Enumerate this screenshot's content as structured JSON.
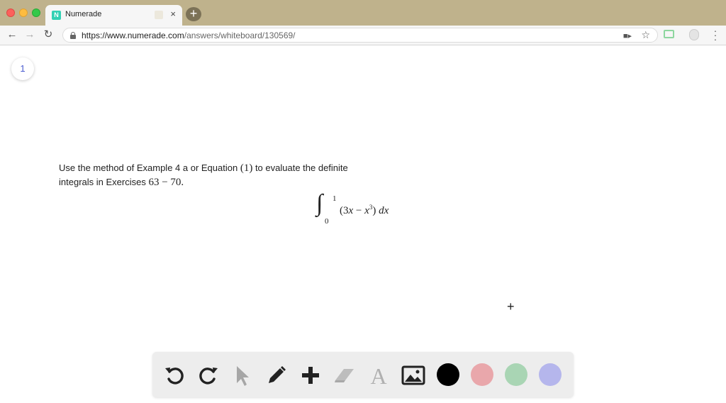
{
  "browser": {
    "tab_title": "Numerade",
    "tab_favicon": "N",
    "tab_close": "×",
    "new_tab": "+",
    "url_host": "https://www.numerade.com",
    "url_path": "/answers/whiteboard/130569/"
  },
  "page": {
    "page_number": "1",
    "problem_line1_text": "Use the method of Example 4 a or Equation ",
    "problem_line1_num": "(1)",
    "problem_line1_rest": " to evaluate the definite",
    "problem_line2_text": "integrals in Exercises ",
    "problem_line2_num": "63 − 70",
    "problem_line2_end": ".",
    "integral": {
      "upper": "1",
      "lower": "0",
      "open": "(3",
      "x1": "x",
      "minus": " − ",
      "x2": "x",
      "power": "3",
      "close": ") ",
      "dx": "dx"
    },
    "cursor_glyph": "+"
  },
  "whiteboard_toolbar": {
    "tools": [
      "undo-icon",
      "redo-icon",
      "pointer-icon",
      "pen-icon",
      "add-icon",
      "eraser-icon",
      "text-icon",
      "image-icon"
    ],
    "colors": [
      "#000000",
      "#e9a7ab",
      "#a9d5b4",
      "#b5b6ec"
    ]
  }
}
